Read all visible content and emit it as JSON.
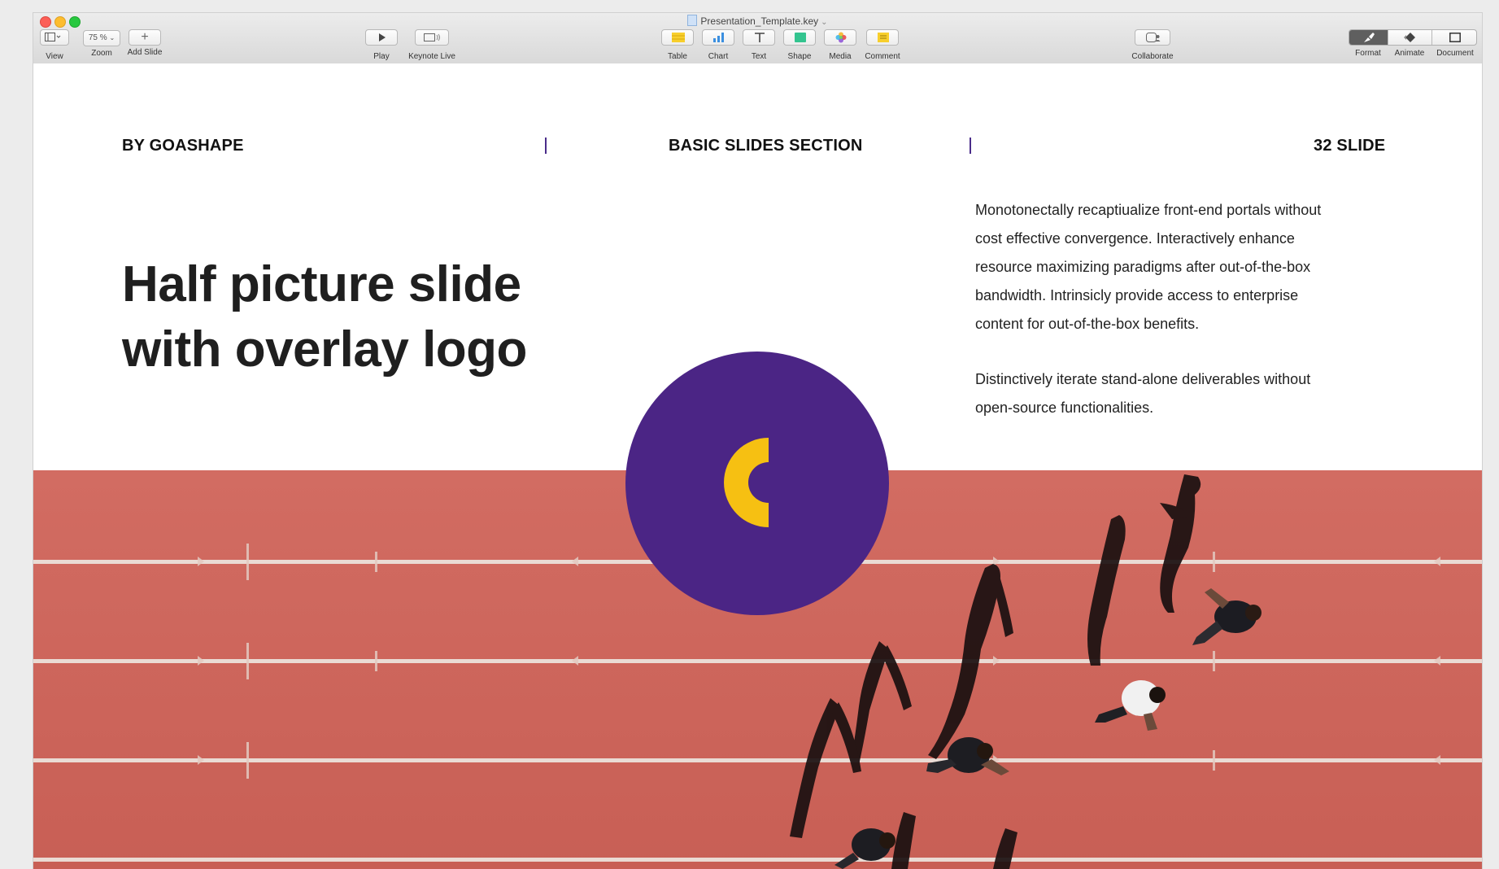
{
  "window": {
    "title": "Presentation_Template.key"
  },
  "toolbar": {
    "view_label": "View",
    "zoom_value": "75 %",
    "zoom_label": "Zoom",
    "add_slide_label": "Add Slide",
    "play_label": "Play",
    "keynote_live_label": "Keynote Live",
    "table_label": "Table",
    "chart_label": "Chart",
    "text_label": "Text",
    "shape_label": "Shape",
    "media_label": "Media",
    "comment_label": "Comment",
    "collaborate_label": "Collaborate",
    "format_label": "Format",
    "animate_label": "Animate",
    "document_label": "Document"
  },
  "slide": {
    "author": "BY GOASHAPE",
    "section": "BASIC SLIDES SECTION",
    "slide_count": "32 SLIDE",
    "title_line1": "Half picture slide",
    "title_line2": "with overlay logo",
    "paragraph1_lines": [
      "Monotonectally recaptiualize front-end portals without",
      "cost effective convergence. Interactively enhance",
      "resource maximizing paradigms after out-of-the-box",
      "bandwidth. Intrinsicly provide access to enterprise",
      "content for out-of-the-box benefits."
    ],
    "paragraph2_lines": [
      "Distinctively iterate stand-alone deliverables without",
      "open-source functionalities."
    ],
    "logo_circle_color": "#4b2585",
    "logo_mark_color": "#f6c012",
    "divider_color": "#4a2c8a",
    "track_color": "#d0695f",
    "photo_subject": "aerial view of runners on red running track"
  }
}
